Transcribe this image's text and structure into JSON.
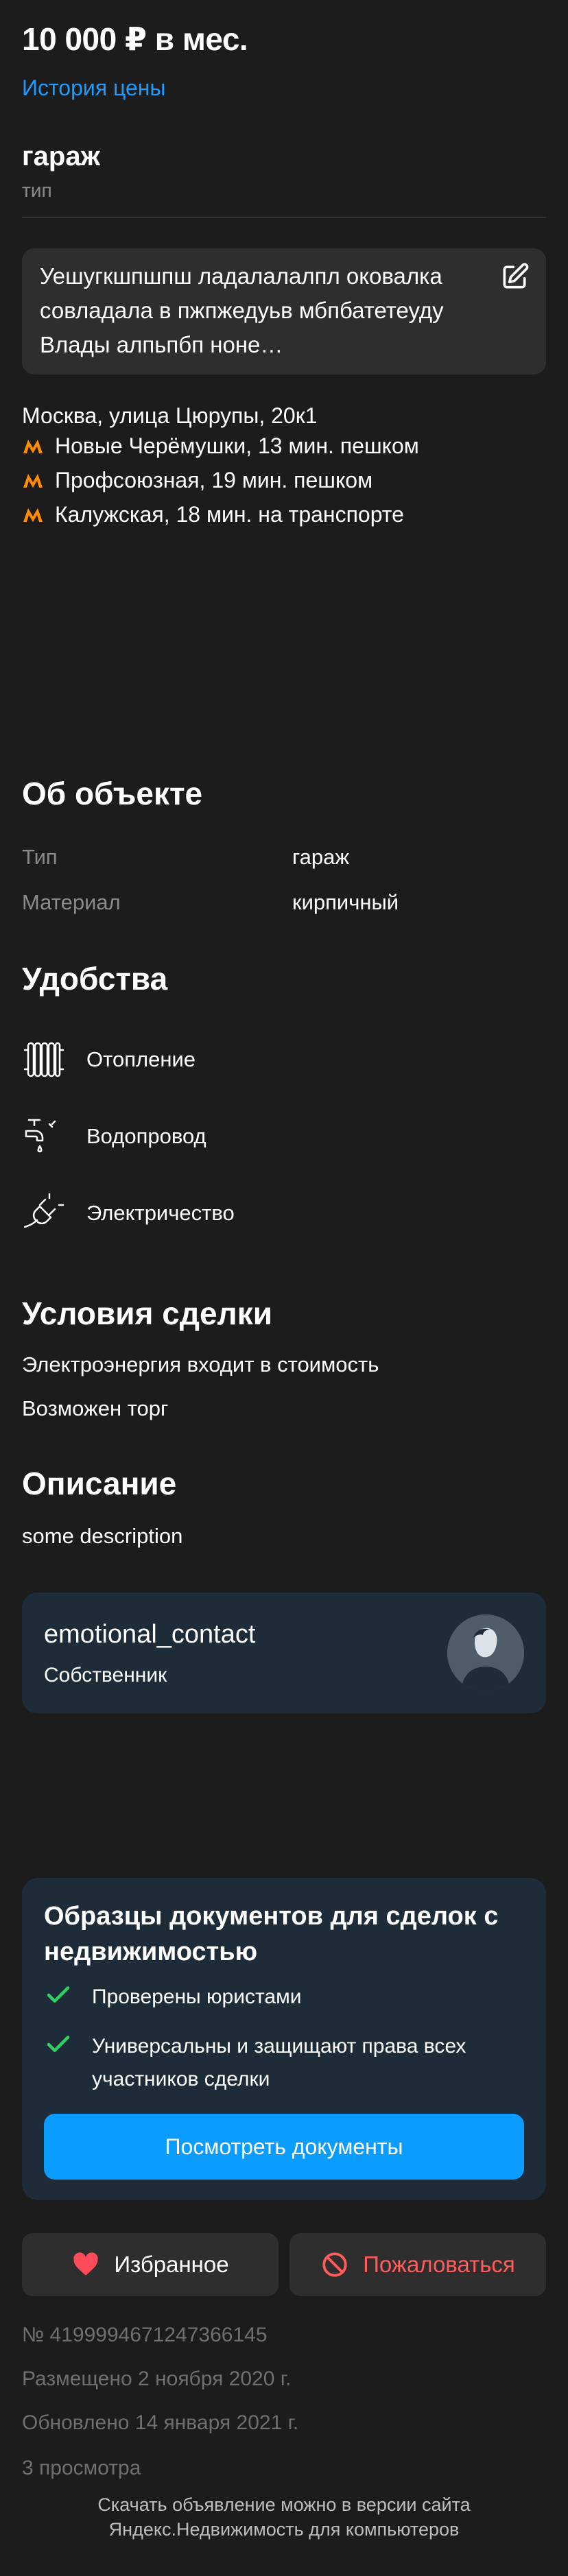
{
  "header": {
    "price": "10 000 ₽ в мес.",
    "price_history_link": "История цены"
  },
  "type_block": {
    "value": "гараж",
    "label": "тип"
  },
  "note": {
    "text": "Уешугкшпшпш ладалалалпл оковалка совладала в пжпжедуьв мбпбатетеуду Влады алпьпбп ноне…",
    "edit_icon": "edit-icon"
  },
  "address": {
    "street": "Москва, улица Цюрупы, 20к1",
    "metro_color": "#ff8c00",
    "metro": [
      {
        "text": "Новые Черёмушки, 13 мин. пешком"
      },
      {
        "text": "Профсоюзная, 19 мин. пешком"
      },
      {
        "text": "Калужская, 18 мин. на транспорте"
      }
    ]
  },
  "about": {
    "title": "Об объекте",
    "rows": [
      {
        "key": "Тип",
        "value": "гараж"
      },
      {
        "key": "Материал",
        "value": "кирпичный"
      }
    ]
  },
  "amenities": {
    "title": "Удобства",
    "items": [
      {
        "label": "Отопление",
        "icon": "radiator-icon"
      },
      {
        "label": "Водопровод",
        "icon": "faucet-icon"
      },
      {
        "label": "Электричество",
        "icon": "plug-icon"
      }
    ]
  },
  "deal": {
    "title": "Условия сделки",
    "items": [
      "Электроэнергия входит в стоимость",
      "Возможен торг"
    ]
  },
  "description": {
    "title": "Описание",
    "text": "some description"
  },
  "owner": {
    "name": "emotional_contact",
    "role": "Собственник"
  },
  "docs": {
    "title": "Образцы документов для сделок с недвижимостью",
    "checks": [
      "Проверены юристами",
      "Универсальны и защищают права всех участников сделки"
    ],
    "button": "Посмотреть документы",
    "check_color": "#2fd15e"
  },
  "actions": {
    "favorite": "Избранное",
    "report": "Пожаловаться",
    "favorite_color": "#ff4a5a",
    "report_color": "#ff5c5c"
  },
  "meta": {
    "id": "№ 4199994671247366145",
    "posted": "Размещено 2 ноября 2020 г.",
    "updated": "Обновлено 14 января 2021 г.",
    "views": "3 просмотра"
  },
  "footer": {
    "line1": "Скачать объявление можно в версии сайта",
    "line2": "Яндекс.Недвижимость для компьютеров"
  }
}
